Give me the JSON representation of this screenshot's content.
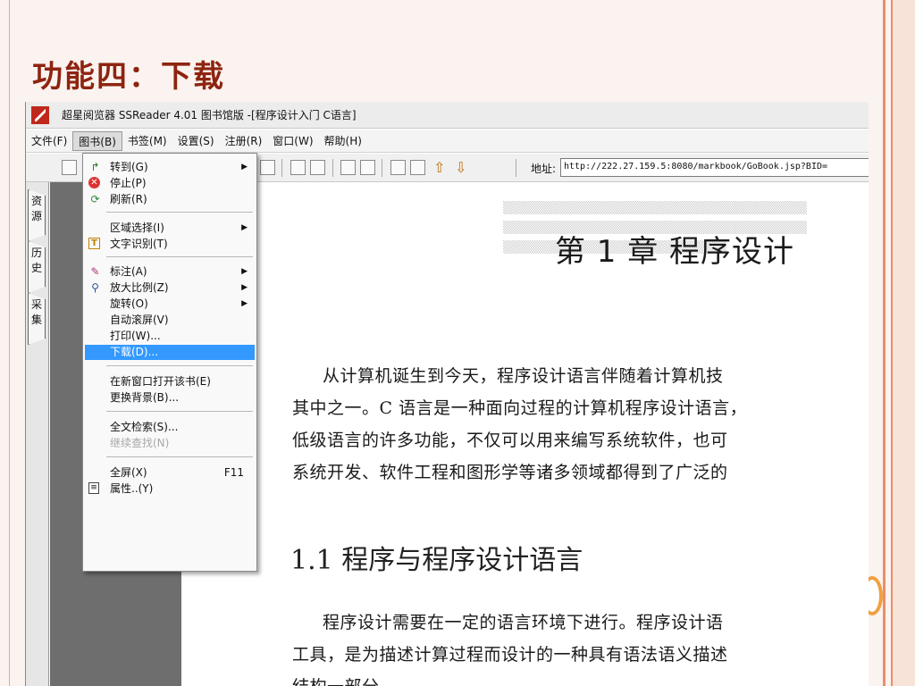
{
  "slide": {
    "title": "功能四：下载"
  },
  "window": {
    "title": "超星阅览器 SSReader 4.01 图书馆版 -[程序设计入门  C语言]"
  },
  "menubar": [
    {
      "label": "文件(F)"
    },
    {
      "label": "图书(B)"
    },
    {
      "label": "书签(M)"
    },
    {
      "label": "设置(S)"
    },
    {
      "label": "注册(R)"
    },
    {
      "label": "窗口(W)"
    },
    {
      "label": "帮助(H)"
    }
  ],
  "toolbar": {
    "address_label": "地址:",
    "address_value": "http://222.27.159.5:8080/markbook/GoBook.jsp?BID="
  },
  "sidebar": {
    "tabs": [
      {
        "label": "资源"
      },
      {
        "label": "历史"
      },
      {
        "label": "采集"
      }
    ]
  },
  "book_menu": {
    "items": [
      {
        "label": "转到(G)",
        "icon": "arrow-icon",
        "submenu": true
      },
      {
        "label": "停止(P)",
        "icon": "stop-icon"
      },
      {
        "label": "刷新(R)",
        "icon": "refresh-icon"
      },
      {
        "label": "区域选择(I)",
        "submenu": true
      },
      {
        "label": "文字识别(T)",
        "icon": "text-recognize-icon"
      },
      {
        "label": "标注(A)",
        "icon": "annotate-icon",
        "submenu": true
      },
      {
        "label": "放大比例(Z)",
        "icon": "magnifier-icon",
        "submenu": true
      },
      {
        "label": "旋转(O)",
        "submenu": true
      },
      {
        "label": "自动滚屏(V)"
      },
      {
        "label": "打印(W)..."
      },
      {
        "label": "下载(D)...",
        "highlighted": true
      },
      {
        "label": "在新窗口打开该书(E)"
      },
      {
        "label": "更换背景(B)..."
      },
      {
        "label": "全文检索(S)..."
      },
      {
        "label": "继续查找(N)",
        "disabled": true
      },
      {
        "label": "全屏(X)",
        "shortcut": "F11"
      },
      {
        "label": "属性..(Y)",
        "icon": "properties-icon"
      }
    ]
  },
  "document": {
    "chapter_title": "第 1 章   程序设计",
    "paragraphs": [
      "从计算机诞生到今天，程序设计语言伴随着计算机技",
      "其中之一。C 语言是一种面向过程的计算机程序设计语言，",
      "低级语言的许多功能，不仅可以用来编写系统软件，也可",
      "系统开发、软件工程和图形学等诸多领域都得到了广泛的"
    ],
    "section_title": "1.1   程序与程序设计语言",
    "paragraphs2": [
      "程序设计需要在一定的语言环境下进行。程序设计语",
      "工具，是为描述计算过程而设计的一种具有语法语义描述",
      "结构一部分"
    ]
  },
  "colors": {
    "title": "#8e2410",
    "highlight": "#3399ff",
    "frame_stripe": "#e98f6a"
  }
}
